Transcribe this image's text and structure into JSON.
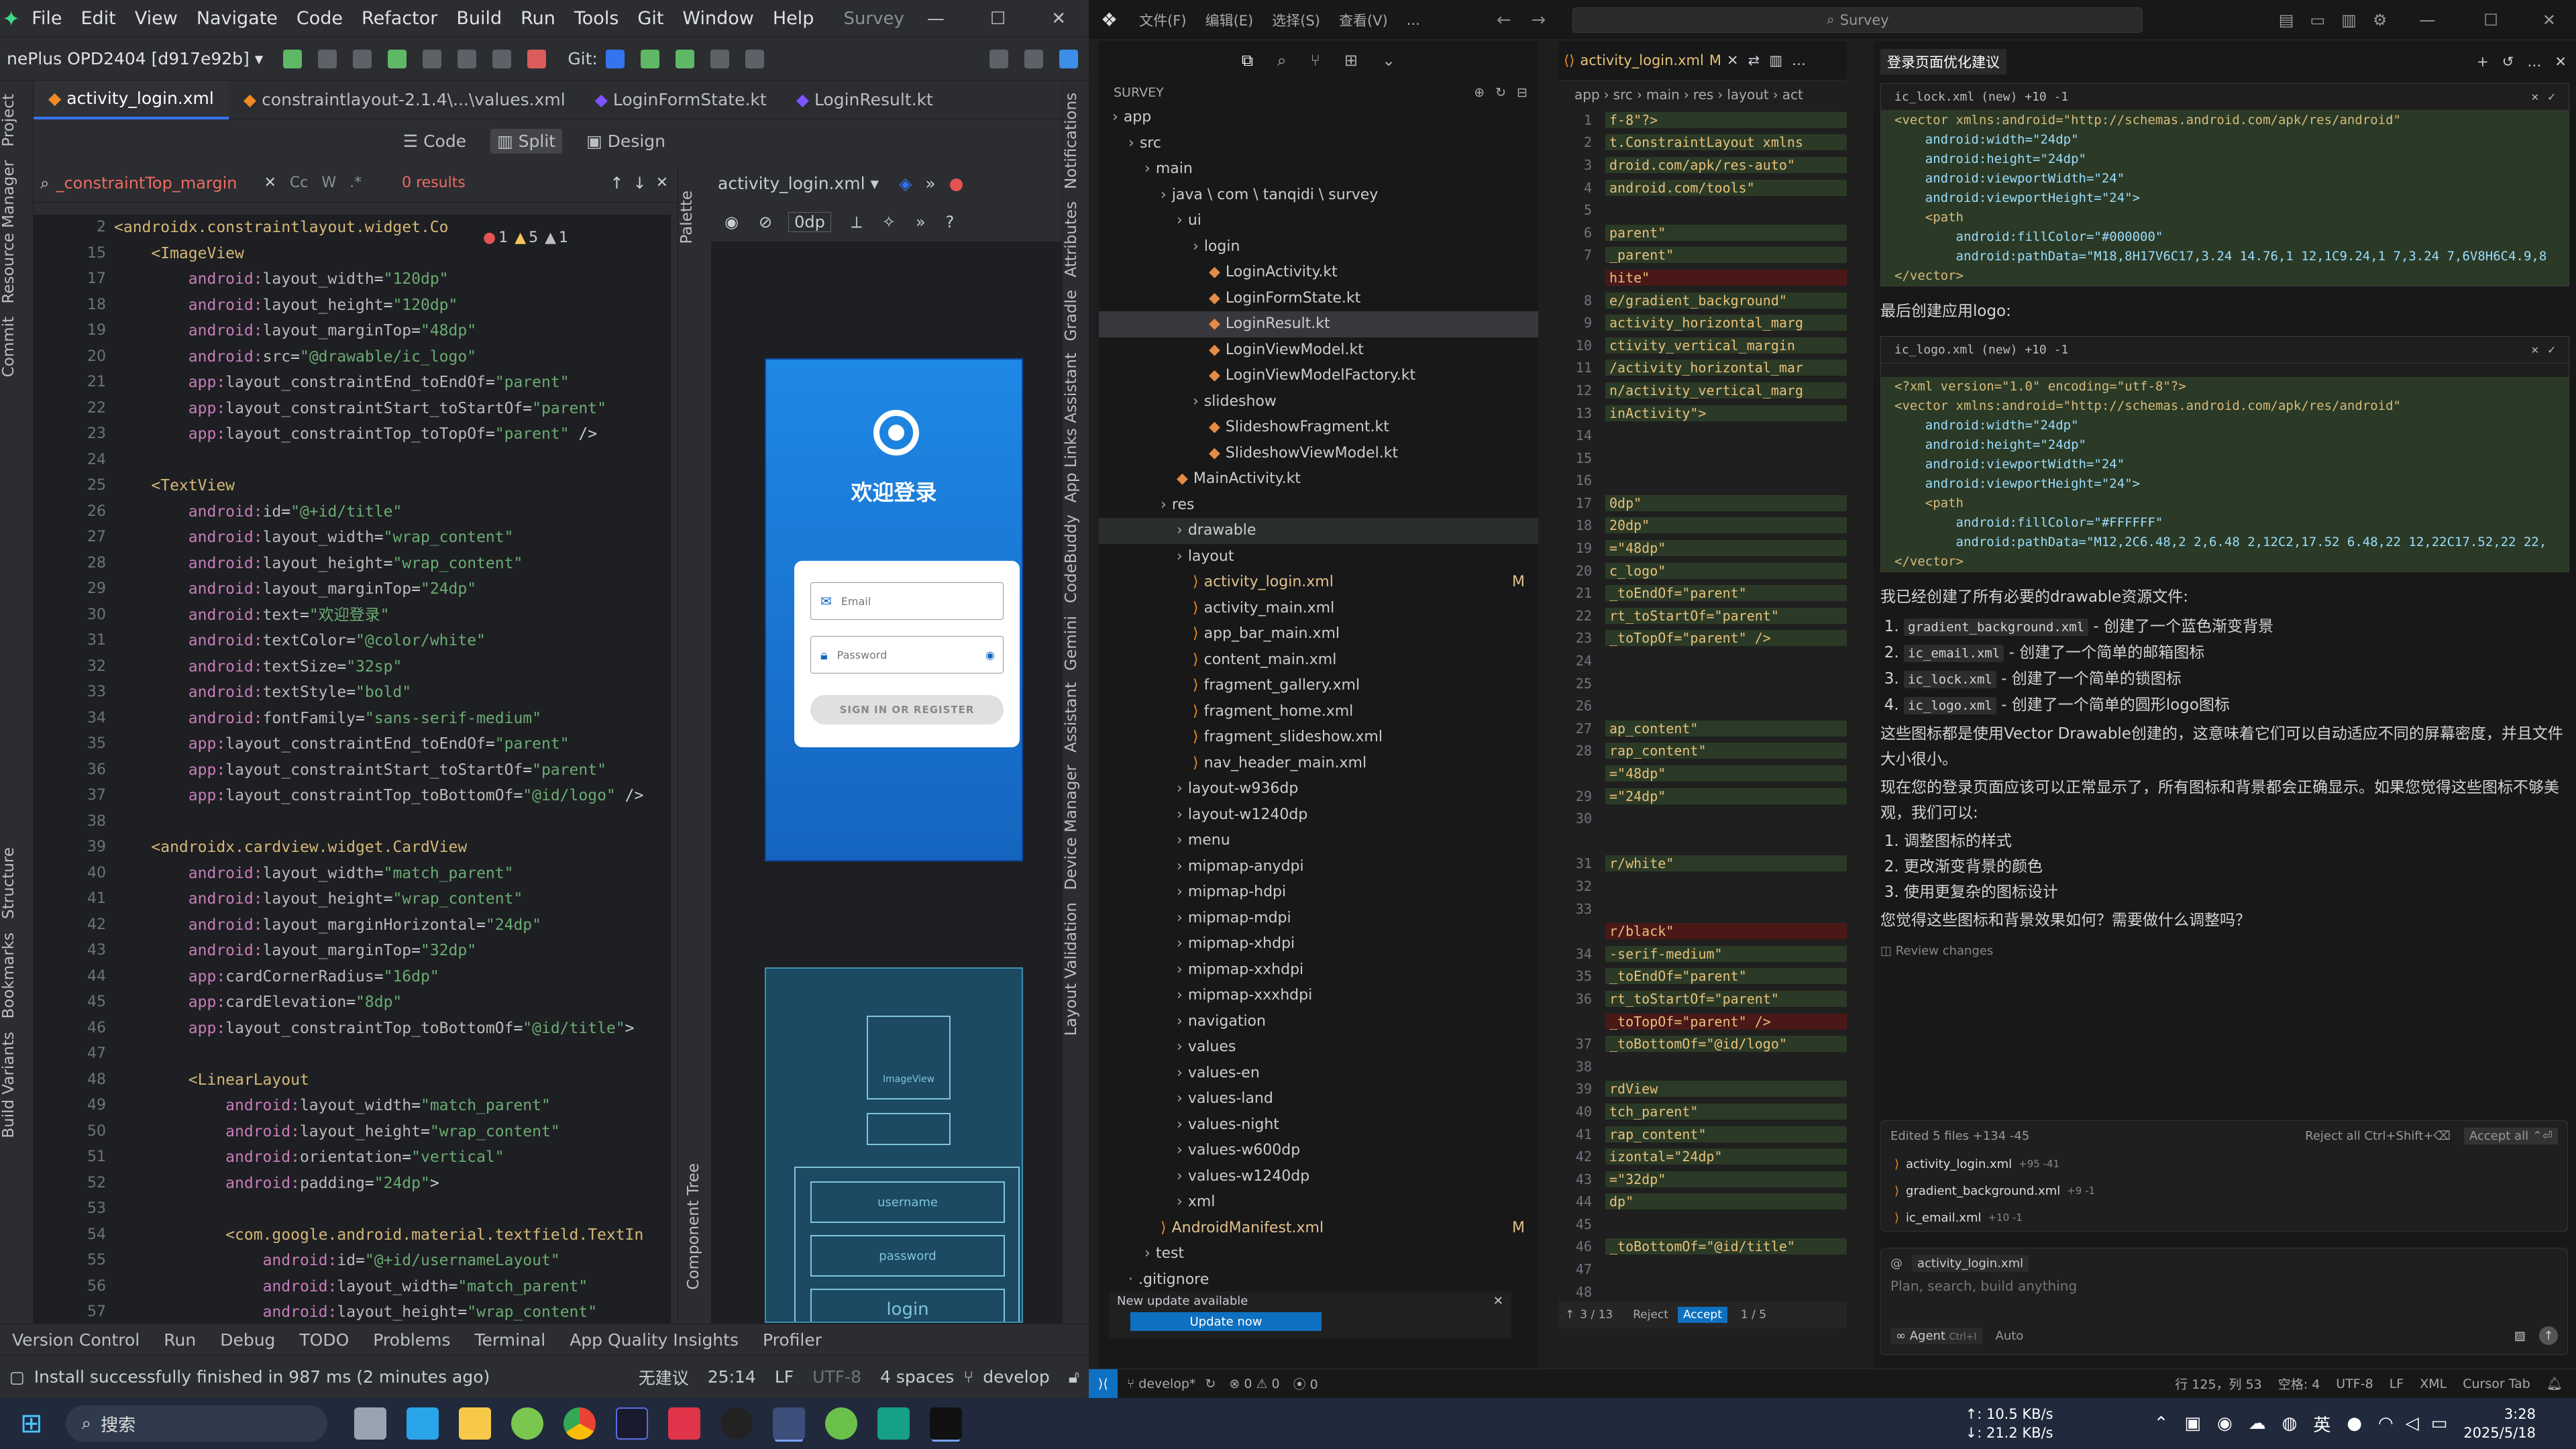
{
  "android_studio": {
    "menu": [
      "File",
      "Edit",
      "View",
      "Navigate",
      "Code",
      "Refactor",
      "Build",
      "Run",
      "Tools",
      "Git",
      "Window",
      "Help"
    ],
    "project_name": "Survey",
    "device": "nePlus OPD2404 [d917e92b]",
    "git_label": "Git:",
    "tabs": [
      "activity_login.xml",
      "constraintlayout-2.1.4\\...\\values.xml",
      "LoginFormState.kt",
      "LoginResult.kt"
    ],
    "view_modes": [
      "Code",
      "Split",
      "Design"
    ],
    "search_value": "_constraintTop_margin",
    "search_results": "0 results",
    "inspections": {
      "errors": "1",
      "warnings": "5",
      "weak": "1"
    },
    "design_file": "activity_login.xml",
    "design_dp": "0dp",
    "left_tools": [
      "Project",
      "Resource Manager",
      "Commit",
      "Structure",
      "Bookmarks",
      "Build Variants"
    ],
    "palette": "Palette",
    "component_tree": "Component Tree",
    "right_tools": [
      "Notifications",
      "Attributes",
      "Gradle",
      "App Links Assistant",
      "CodeBuddy",
      "Gemini",
      "Assistant",
      "Device Manager",
      "Layout Validation"
    ],
    "code_lines": [
      {
        "n": "2",
        "t": "<androidx.constraintlayout.widget.Co"
      },
      {
        "n": "15",
        "t": "    <ImageView"
      },
      {
        "n": "17",
        "t": "        android:layout_width=\"120dp\""
      },
      {
        "n": "18",
        "t": "        android:layout_height=\"120dp\""
      },
      {
        "n": "19",
        "t": "        android:layout_marginTop=\"48dp\""
      },
      {
        "n": "20",
        "t": "        android:src=\"@drawable/ic_logo\""
      },
      {
        "n": "21",
        "t": "        app:layout_constraintEnd_toEndOf=\"parent\""
      },
      {
        "n": "22",
        "t": "        app:layout_constraintStart_toStartOf=\"parent\""
      },
      {
        "n": "23",
        "t": "        app:layout_constraintTop_toTopOf=\"parent\" />"
      },
      {
        "n": "24",
        "t": ""
      },
      {
        "n": "25",
        "t": "    <TextView"
      },
      {
        "n": "26",
        "t": "        android:id=\"@+id/title\""
      },
      {
        "n": "27",
        "t": "        android:layout_width=\"wrap_content\""
      },
      {
        "n": "28",
        "t": "        android:layout_height=\"wrap_content\""
      },
      {
        "n": "29",
        "t": "        android:layout_marginTop=\"24dp\""
      },
      {
        "n": "30",
        "t": "        android:text=\"欢迎登录\""
      },
      {
        "n": "31",
        "t": "        android:textColor=\"@color/white\""
      },
      {
        "n": "32",
        "t": "        android:textSize=\"32sp\""
      },
      {
        "n": "33",
        "t": "        android:textStyle=\"bold\""
      },
      {
        "n": "34",
        "t": "        android:fontFamily=\"sans-serif-medium\""
      },
      {
        "n": "35",
        "t": "        app:layout_constraintEnd_toEndOf=\"parent\""
      },
      {
        "n": "36",
        "t": "        app:layout_constraintStart_toStartOf=\"parent\""
      },
      {
        "n": "37",
        "t": "        app:layout_constraintTop_toBottomOf=\"@id/logo\" />"
      },
      {
        "n": "38",
        "t": ""
      },
      {
        "n": "39",
        "t": "    <androidx.cardview.widget.CardView"
      },
      {
        "n": "40",
        "t": "        android:layout_width=\"match_parent\""
      },
      {
        "n": "41",
        "t": "        android:layout_height=\"wrap_content\""
      },
      {
        "n": "42",
        "t": "        android:layout_marginHorizontal=\"24dp\""
      },
      {
        "n": "43",
        "t": "        android:layout_marginTop=\"32dp\""
      },
      {
        "n": "44",
        "t": "        app:cardCornerRadius=\"16dp\""
      },
      {
        "n": "45",
        "t": "        app:cardElevation=\"8dp\""
      },
      {
        "n": "46",
        "t": "        app:layout_constraintTop_toBottomOf=\"@id/title\">"
      },
      {
        "n": "47",
        "t": ""
      },
      {
        "n": "48",
        "t": "        <LinearLayout"
      },
      {
        "n": "49",
        "t": "            android:layout_width=\"match_parent\""
      },
      {
        "n": "50",
        "t": "            android:layout_height=\"wrap_content\""
      },
      {
        "n": "51",
        "t": "            android:orientation=\"vertical\""
      },
      {
        "n": "52",
        "t": "            android:padding=\"24dp\">"
      },
      {
        "n": "53",
        "t": ""
      },
      {
        "n": "54",
        "t": "            <com.google.android.material.textfield.TextIn"
      },
      {
        "n": "55",
        "t": "                android:id=\"@+id/usernameLayout\""
      },
      {
        "n": "56",
        "t": "                android:layout_width=\"match_parent\""
      },
      {
        "n": "57",
        "t": "                android:layout_height=\"wrap_content\""
      }
    ],
    "preview": {
      "welcome": "欢迎登录",
      "email_hint": "Email",
      "password_hint": "Password",
      "sign_in": "SIGN IN OR REGISTER",
      "blueprint_image": "ImageView",
      "blueprint_username": "username",
      "blueprint_password": "password",
      "blueprint_login": "login"
    },
    "bottom_tools": [
      "Version Control",
      "Run",
      "Debug",
      "TODO",
      "Problems",
      "Terminal",
      "App Quality Insights",
      "Profiler"
    ],
    "status_message": "Install successfully finished in 987 ms (2 minutes ago)",
    "status_right": {
      "ime": "无建议",
      "pos": "25:14",
      "le": "LF",
      "enc": "UTF-8",
      "indent": "4 spaces",
      "branch": "develop"
    }
  },
  "vscode": {
    "menu": [
      "文件(F)",
      "编辑(E)",
      "选择(S)",
      "查看(V)",
      "..."
    ],
    "search": "Survey",
    "explorer_title": "SURVEY",
    "tree": [
      {
        "d": 0,
        "t": "app",
        "k": "folder"
      },
      {
        "d": 1,
        "t": "src",
        "k": "folder"
      },
      {
        "d": 2,
        "t": "main",
        "k": "folder"
      },
      {
        "d": 3,
        "t": "java \\ com \\ tanqidi \\ survey",
        "k": "folder"
      },
      {
        "d": 4,
        "t": "ui",
        "k": "folder"
      },
      {
        "d": 5,
        "t": "login",
        "k": "folder"
      },
      {
        "d": 6,
        "t": "LoginActivity.kt",
        "k": "kt"
      },
      {
        "d": 6,
        "t": "LoginFormState.kt",
        "k": "kt"
      },
      {
        "d": 6,
        "t": "LoginResult.kt",
        "k": "kt",
        "sel": true
      },
      {
        "d": 6,
        "t": "LoginViewModel.kt",
        "k": "kt"
      },
      {
        "d": 6,
        "t": "LoginViewModelFactory.kt",
        "k": "kt"
      },
      {
        "d": 5,
        "t": "slideshow",
        "k": "folder"
      },
      {
        "d": 6,
        "t": "SlideshowFragment.kt",
        "k": "kt"
      },
      {
        "d": 6,
        "t": "SlideshowViewModel.kt",
        "k": "kt"
      },
      {
        "d": 4,
        "t": "MainActivity.kt",
        "k": "kt"
      },
      {
        "d": 3,
        "t": "res",
        "k": "folder"
      },
      {
        "d": 4,
        "t": "drawable",
        "k": "folder",
        "hl": true
      },
      {
        "d": 4,
        "t": "layout",
        "k": "folder"
      },
      {
        "d": 5,
        "t": "activity_login.xml",
        "k": "xml",
        "m": "M"
      },
      {
        "d": 5,
        "t": "activity_main.xml",
        "k": "xml"
      },
      {
        "d": 5,
        "t": "app_bar_main.xml",
        "k": "xml"
      },
      {
        "d": 5,
        "t": "content_main.xml",
        "k": "xml"
      },
      {
        "d": 5,
        "t": "fragment_gallery.xml",
        "k": "xml"
      },
      {
        "d": 5,
        "t": "fragment_home.xml",
        "k": "xml"
      },
      {
        "d": 5,
        "t": "fragment_slideshow.xml",
        "k": "xml"
      },
      {
        "d": 5,
        "t": "nav_header_main.xml",
        "k": "xml"
      },
      {
        "d": 4,
        "t": "layout-w936dp",
        "k": "folder"
      },
      {
        "d": 4,
        "t": "layout-w1240dp",
        "k": "folder"
      },
      {
        "d": 4,
        "t": "menu",
        "k": "folder"
      },
      {
        "d": 4,
        "t": "mipmap-anydpi",
        "k": "folder"
      },
      {
        "d": 4,
        "t": "mipmap-hdpi",
        "k": "folder"
      },
      {
        "d": 4,
        "t": "mipmap-mdpi",
        "k": "folder"
      },
      {
        "d": 4,
        "t": "mipmap-xhdpi",
        "k": "folder"
      },
      {
        "d": 4,
        "t": "mipmap-xxhdpi",
        "k": "folder"
      },
      {
        "d": 4,
        "t": "mipmap-xxxhdpi",
        "k": "folder"
      },
      {
        "d": 4,
        "t": "navigation",
        "k": "folder"
      },
      {
        "d": 4,
        "t": "values",
        "k": "folder"
      },
      {
        "d": 4,
        "t": "values-en",
        "k": "folder"
      },
      {
        "d": 4,
        "t": "values-land",
        "k": "folder"
      },
      {
        "d": 4,
        "t": "values-night",
        "k": "folder"
      },
      {
        "d": 4,
        "t": "values-w600dp",
        "k": "folder"
      },
      {
        "d": 4,
        "t": "values-w1240dp",
        "k": "folder"
      },
      {
        "d": 4,
        "t": "xml",
        "k": "folder"
      },
      {
        "d": 3,
        "t": "AndroidManifest.xml",
        "k": "xml",
        "m": "M"
      },
      {
        "d": 2,
        "t": "test",
        "k": "folder"
      },
      {
        "d": 1,
        "t": ".gitignore",
        "k": "file"
      }
    ],
    "update_text": "New update available",
    "update_button": "Update now",
    "editor_tab": "activity_login.xml",
    "editor_tab_mark": "M",
    "breadcrumb": [
      "app",
      "src",
      "main",
      "res",
      "layout",
      "act"
    ],
    "editor_lines": [
      {
        "n": "1",
        "t": "f-8\"?>"
      },
      {
        "n": "2",
        "t": "t.ConstraintLayout xmlns"
      },
      {
        "n": "3",
        "t": "droid.com/apk/res-auto\""
      },
      {
        "n": "4",
        "t": "android.com/tools\""
      },
      {
        "n": "5",
        "t": ""
      },
      {
        "n": "6",
        "t": "parent\""
      },
      {
        "n": "7",
        "t": "_parent\""
      },
      {
        "n": "",
        "t": "hite\""
      },
      {
        "n": "8",
        "t": "e/gradient_background\""
      },
      {
        "n": "9",
        "t": "activity_horizontal_marg"
      },
      {
        "n": "10",
        "t": "ctivity_vertical_margin"
      },
      {
        "n": "11",
        "t": "/activity_horizontal_mar"
      },
      {
        "n": "12",
        "t": "n/activity_vertical_marg"
      },
      {
        "n": "13",
        "t": "inActivity\">"
      },
      {
        "n": "14",
        "t": ""
      },
      {
        "n": "15",
        "t": ""
      },
      {
        "n": "16",
        "t": ""
      },
      {
        "n": "17",
        "t": "0dp\""
      },
      {
        "n": "18",
        "t": "20dp\""
      },
      {
        "n": "19",
        "t": "=\"48dp\""
      },
      {
        "n": "20",
        "t": "c_logo\""
      },
      {
        "n": "21",
        "t": "_toEndOf=\"parent\""
      },
      {
        "n": "22",
        "t": "rt_toStartOf=\"parent\""
      },
      {
        "n": "23",
        "t": "_toTopOf=\"parent\" />"
      },
      {
        "n": "24",
        "t": ""
      },
      {
        "n": "25",
        "t": ""
      },
      {
        "n": "26",
        "t": ""
      },
      {
        "n": "27",
        "t": "ap_content\""
      },
      {
        "n": "28",
        "t": "rap_content\""
      },
      {
        "n": "",
        "t": "=\"48dp\""
      },
      {
        "n": "29",
        "t": "=\"24dp\""
      },
      {
        "n": "30",
        "t": ""
      },
      {
        "n": "",
        "t": ""
      },
      {
        "n": "31",
        "t": "r/white\""
      },
      {
        "n": "32",
        "t": ""
      },
      {
        "n": "33",
        "t": ""
      },
      {
        "n": "",
        "t": "r/black\""
      },
      {
        "n": "34",
        "t": "-serif-medium\""
      },
      {
        "n": "35",
        "t": "_toEndOf=\"parent\""
      },
      {
        "n": "36",
        "t": "rt_toStartOf=\"parent\""
      },
      {
        "n": "",
        "t": "_toTopOf=\"parent\" />"
      },
      {
        "n": "37",
        "t": "_toBottomOf=\"@id/logo\""
      },
      {
        "n": "38",
        "t": ""
      },
      {
        "n": "39",
        "t": "rdView"
      },
      {
        "n": "40",
        "t": "tch_parent\""
      },
      {
        "n": "41",
        "t": "rap_content\""
      },
      {
        "n": "42",
        "t": "izontal=\"24dp\""
      },
      {
        "n": "43",
        "t": "=\"32dp\""
      },
      {
        "n": "44",
        "t": "dp\""
      },
      {
        "n": "45",
        "t": ""
      },
      {
        "n": "46",
        "t": "_toBottomOf=\"@id/title\""
      },
      {
        "n": "47",
        "t": ""
      },
      {
        "n": "48",
        "t": ""
      },
      {
        "n": "",
        "t": "=\"match_parent\""
      }
    ],
    "diff_nav": {
      "pos": "3 / 13",
      "reject": "Reject",
      "accept": "Accept",
      "pages": "1 / 5"
    },
    "chat": {
      "title": "登录页面优化建议",
      "box1_name": "ic_lock.xml",
      "box1_meta": "(new) +10 -1",
      "box1_lines": [
        "<vector xmlns:android=\"http://schemas.android.com/apk/res/android\"",
        "    android:width=\"24dp\"",
        "    android:height=\"24dp\"",
        "    android:viewportWidth=\"24\"",
        "    android:viewportHeight=\"24\">",
        "    <path",
        "        android:fillColor=\"#000000\"",
        "        android:pathData=\"M18,8H17V6C17,3.24 14.76,1 12,1C9.24,1 7,3.24 7,6V8H6C4.9,8",
        "</vector>"
      ],
      "text1": "最后创建应用logo:",
      "box2_name": "ic_logo.xml",
      "box2_meta": "(new) +10 -1",
      "box2_lines": [
        "<?xml version=\"1.0\" encoding=\"utf-8\"?>",
        "<vector xmlns:android=\"http://schemas.android.com/apk/res/android\"",
        "    android:width=\"24dp\"",
        "    android:height=\"24dp\"",
        "    android:viewportWidth=\"24\"",
        "    android:viewportHeight=\"24\">",
        "    <path",
        "        android:fillColor=\"#FFFFFF\"",
        "        android:pathData=\"M12,2C6.48,2 2,6.48 2,12C2,17.52 6.48,22 12,22C17.52,22 22,",
        "</vector>"
      ],
      "text2": "我已经创建了所有必要的drawable资源文件:",
      "list1": [
        {
          "chip": "gradient_background.xml",
          "d": " - 创建了一个蓝色渐变背景"
        },
        {
          "chip": "ic_email.xml",
          "d": " - 创建了一个简单的邮箱图标"
        },
        {
          "chip": "ic_lock.xml",
          "d": " - 创建了一个简单的锁图标"
        },
        {
          "chip": "ic_logo.xml",
          "d": " - 创建了一个简单的圆形logo图标"
        }
      ],
      "text3": "这些图标都是使用Vector Drawable创建的，这意味着它们可以自动适应不同的屏幕密度，并且文件大小很小。",
      "text4": "现在您的登录页面应该可以正常显示了，所有图标和背景都会正确显示。如果您觉得这些图标不够美观，我们可以:",
      "list2": [
        "调整图标的样式",
        "更改渐变背景的颜色",
        "使用更复杂的图标设计"
      ],
      "text5": "您觉得这些图标和背景效果如何？需要做什么调整吗？",
      "review": "Review changes",
      "edited": "Edited 5 files +134 -45",
      "reject_all": "Reject all Ctrl+Shift+⌫",
      "accept_all": "Accept all ⌃⏎",
      "edited_files": [
        {
          "f": "activity_login.xml",
          "d": "+95 -41"
        },
        {
          "f": "gradient_background.xml",
          "d": "+9 -1"
        },
        {
          "f": "ic_email.xml",
          "d": "+10 -1"
        }
      ],
      "context_file": "activity_login.xml",
      "input_placeholder": "Plan, search, build anything",
      "mode": "Agent",
      "mode_key": "Ctrl+I",
      "model": "Auto"
    },
    "status": {
      "branch": "develop*",
      "problems": "⊗ 0 ⚠ 0",
      "ports": "0",
      "pos": "行 125，列 53",
      "spaces": "空格: 4",
      "enc": "UTF-8",
      "le": "LF",
      "lang": "XML",
      "cursor": "Cursor Tab"
    }
  },
  "taskbar": {
    "search": "搜索",
    "net_up": "↑: 10.5 KB/s",
    "net_down": "↓: 21.2 KB/s",
    "ime": "英",
    "time": "3:28",
    "date": "2025/5/18"
  }
}
